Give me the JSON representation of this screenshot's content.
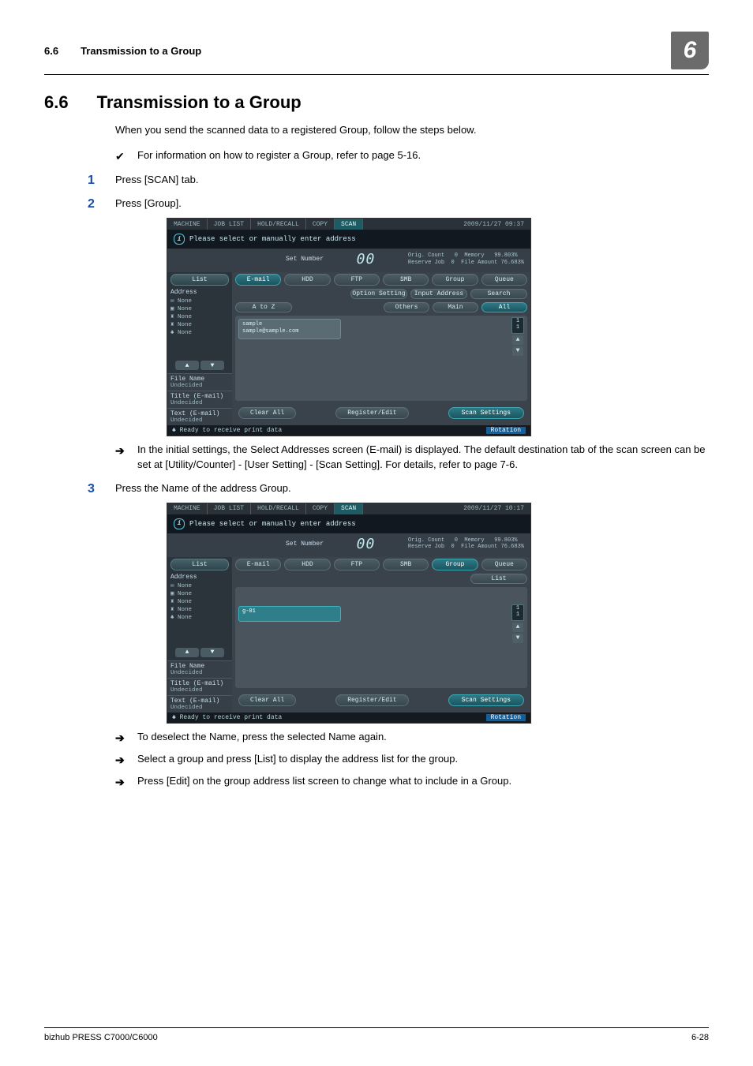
{
  "header": {
    "section_num": "6.6",
    "section_title": "Transmission to a Group",
    "chapter_badge": "6"
  },
  "title": {
    "num": "6.6",
    "text": "Transmission to a Group"
  },
  "intro": "When you send the scanned data to a registered Group, follow the steps below.",
  "premise": "For information on how to register a Group, refer to page 5-16.",
  "steps": {
    "s1": {
      "n": "1",
      "t": "Press [SCAN] tab."
    },
    "s2": {
      "n": "2",
      "t": "Press [Group]."
    },
    "s3": {
      "n": "3",
      "t": "Press the Name of the address Group."
    }
  },
  "after2": "In the initial settings, the Select Addresses screen (E-mail) is displayed.  The default destination tab of the scan screen can be set at [Utility/Counter] - [User Setting] - [Scan Setting]. For details, refer to page 7-6.",
  "after3": {
    "a": "To deselect the Name, press the selected Name again.",
    "b": "Select a group and press [List] to display the address list for the group.",
    "c": "Press [Edit] on the group address list screen to change what to include in a Group."
  },
  "panel": {
    "tabs": {
      "machine": "MACHINE",
      "joblist": "JOB LIST",
      "hold": "HOLD/RECALL",
      "copy": "COPY",
      "scan": "SCAN"
    },
    "dt1": "2009/11/27 09:37",
    "dt2": "2009/11/27 10:17",
    "info": "Please select or manually enter address",
    "strip": {
      "setnum_l": "Set Number",
      "setnum_v": "00",
      "orig": "Orig. Count",
      "orig_v": "0",
      "reserve": "Reserve Job",
      "reserve_v": "0",
      "memory": "Memory",
      "memory_v": "99.803%",
      "file": "File Amount",
      "file_v": "76.683%"
    },
    "side": {
      "list": "List",
      "addr": "Address",
      "none": "None",
      "section": {
        "fname": "File Name",
        "title": "Title (E-mail)",
        "text": "Text (E-mail)",
        "undecided": "Undecided"
      }
    },
    "top_chips": {
      "email": "E-mail",
      "hdd": "HDD",
      "ftp": "FTP",
      "smb": "SMB",
      "group": "Group",
      "queue": "Queue"
    },
    "row2": {
      "option": "Option Setting",
      "input": "Input Address",
      "search": "Search"
    },
    "row3": {
      "atoz": "A to Z",
      "others": "Others",
      "main": "Main",
      "all": "All"
    },
    "list_btn": "List",
    "cell1": {
      "name": "sample",
      "addr": "sample@sample.com"
    },
    "cell2": "g-01",
    "page": {
      "cur": "1",
      "tot": "1"
    },
    "bottom": {
      "clear": "Clear All",
      "register": "Register/Edit",
      "scanset": "Scan Settings"
    },
    "status": {
      "msg": "Ready to receive print data",
      "rot": "Rotation"
    }
  },
  "footer": {
    "left": "bizhub PRESS C7000/C6000",
    "right": "6-28"
  }
}
